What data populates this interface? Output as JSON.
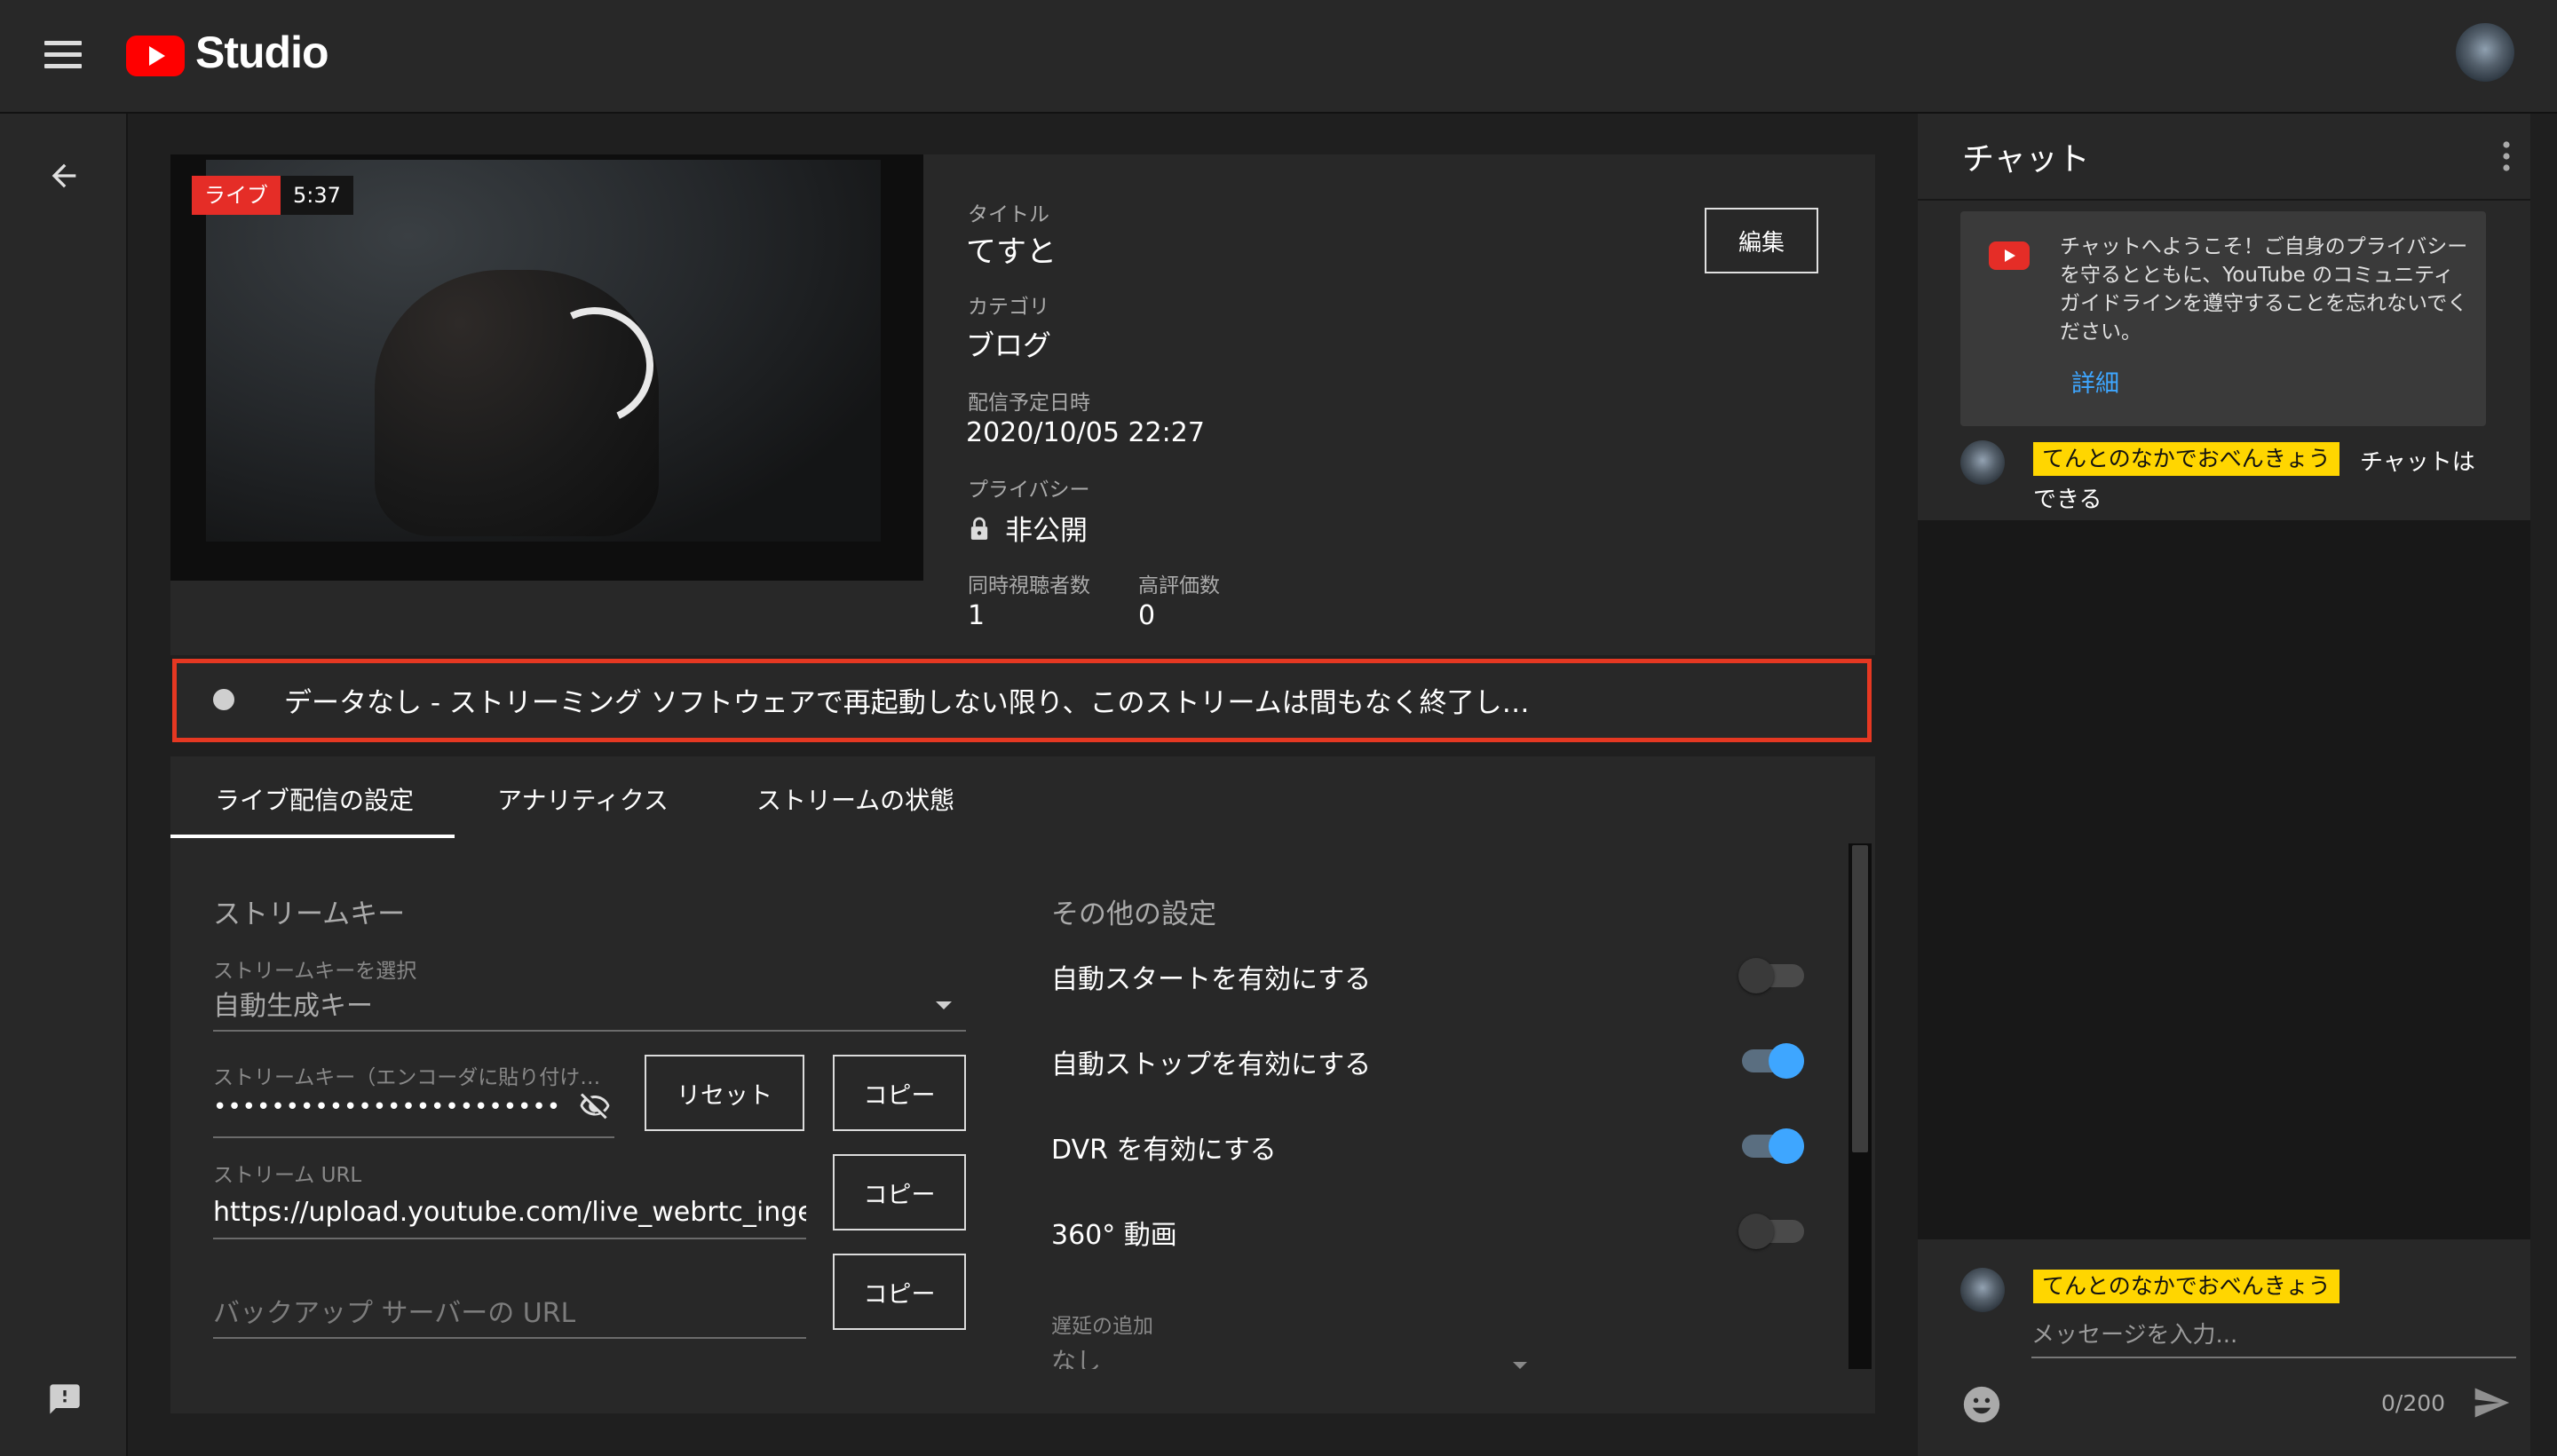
{
  "header": {
    "logo_text": "Studio"
  },
  "video": {
    "live_label": "ライブ",
    "live_time": "5:37"
  },
  "info": {
    "title_label": "タイトル",
    "title_value": "てすと",
    "category_label": "カテゴリ",
    "category_value": "ブログ",
    "schedule_label": "配信予定日時",
    "schedule_value": "2020/10/05 22:27",
    "privacy_label": "プライバシー",
    "privacy_value": "非公開",
    "viewers_label": "同時視聴者数",
    "viewers_value": "1",
    "likes_label": "高評価数",
    "likes_value": "0",
    "edit_label": "編集"
  },
  "status": {
    "text": "データなし - ストリーミング ソフトウェアで再起動しない限り、このストリームは間もなく終了し…"
  },
  "tabs": [
    {
      "label": "ライブ配信の設定"
    },
    {
      "label": "アナリティクス"
    },
    {
      "label": "ストリームの状態"
    }
  ],
  "stream_key": {
    "section_title": "ストリームキー",
    "select_label": "ストリームキーを選択",
    "select_value": "自動生成キー",
    "key_label": "ストリームキー（エンコーダに貼り付け…",
    "key_value": "••••••••••••••••••••••••",
    "reset_label": "リセット",
    "copy_label": "コピー",
    "url_label": "ストリーム URL",
    "url_value": "https://upload.youtube.com/live_webrtc_ingest",
    "backup_placeholder": "バックアップ サーバーの URL"
  },
  "other_settings": {
    "section_title": "その他の設定",
    "toggles": [
      {
        "label": "自動スタートを有効にする",
        "enabled": false
      },
      {
        "label": "自動ストップを有効にする",
        "enabled": true
      },
      {
        "label": "DVR を有効にする",
        "enabled": true
      },
      {
        "label": "360° 動画",
        "enabled": false
      }
    ],
    "latency_label": "遅延の追加",
    "latency_value": "なし"
  },
  "chat": {
    "title": "チャット",
    "welcome_text": "チャットへようこそ！ご自身のプライバシーを守るとともに、YouTube のコミュニティ ガイドラインを遵守することを忘れないでください。",
    "details_label": "詳細",
    "messages": [
      {
        "author": "てんとのなかでおべんきょう",
        "text_line1": "チャットは",
        "text_line2": "できる"
      }
    ],
    "current_user": "てんとのなかでおべんきょう",
    "input_placeholder": "メッセージを入力...",
    "char_count": "0/200"
  },
  "colors": {
    "accent_blue": "#3ea6ff",
    "live_red": "#e52d27",
    "status_border": "#e53822",
    "chip_yellow": "#ffd600"
  },
  "icons": {
    "menu": "menu-icon",
    "back": "arrow-back-icon",
    "feedback": "feedback-icon",
    "lock": "lock-icon",
    "visibility_off": "visibility-off-icon",
    "dropdown": "chevron-down-icon",
    "more": "more-vert-icon",
    "emoji": "emoji-icon",
    "send": "send-icon"
  }
}
